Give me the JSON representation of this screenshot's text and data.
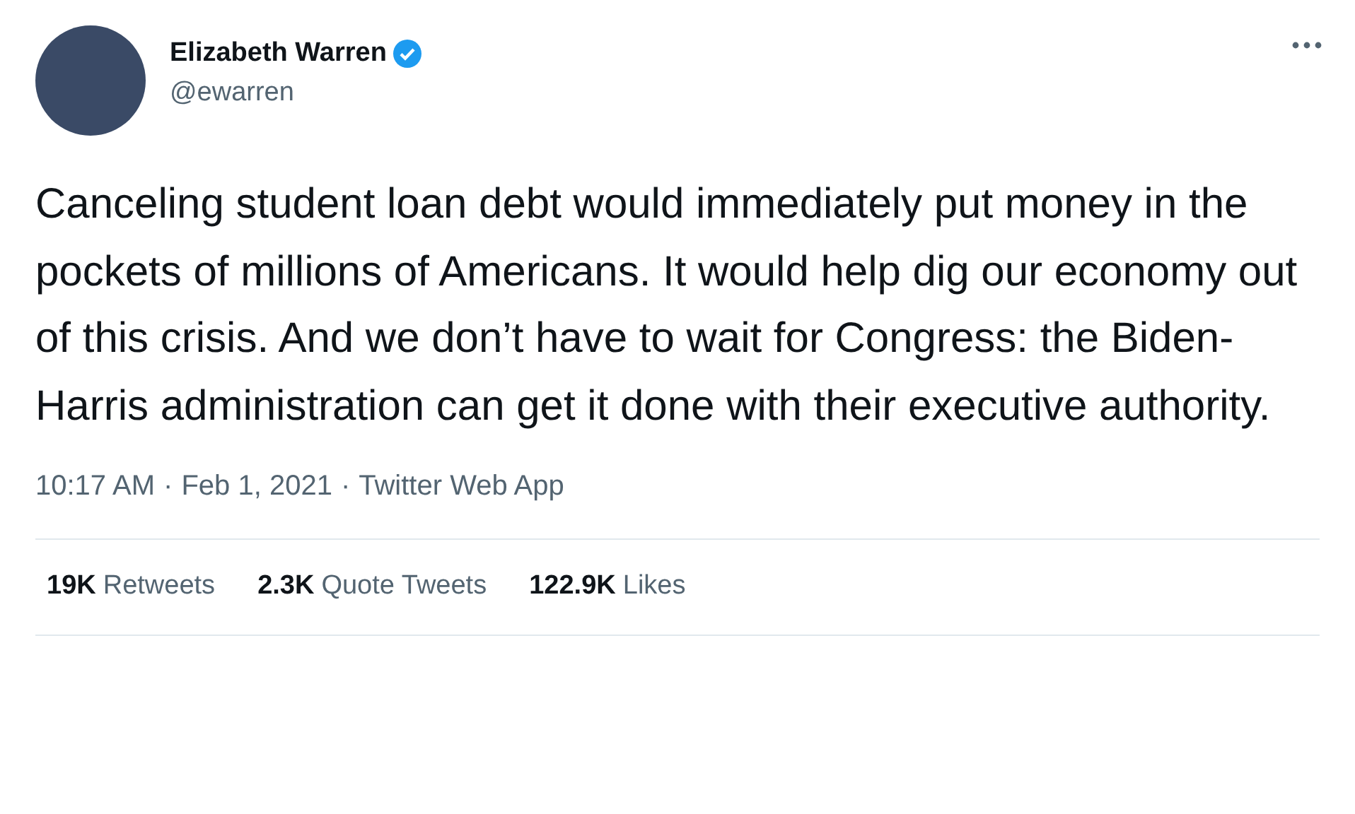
{
  "author": {
    "name": "Elizabeth Warren",
    "verified": true,
    "handle": "@ewarren"
  },
  "tweet": {
    "text": "Canceling student loan debt would immediately put money in the pockets of millions of Americans. It would help dig our economy out of this crisis. And we don’t have to wait for Congress: the Biden-Harris administration can get it done with their executive authority."
  },
  "meta": {
    "time": "10:17 AM",
    "separator_1": "·",
    "date": "Feb 1, 2021",
    "separator_2": "·",
    "source": "Twitter Web App"
  },
  "stats": [
    {
      "count": "19K",
      "label": "Retweets"
    },
    {
      "count": "2.3K",
      "label": "Quote Tweets"
    },
    {
      "count": "122.9K",
      "label": "Likes"
    }
  ]
}
